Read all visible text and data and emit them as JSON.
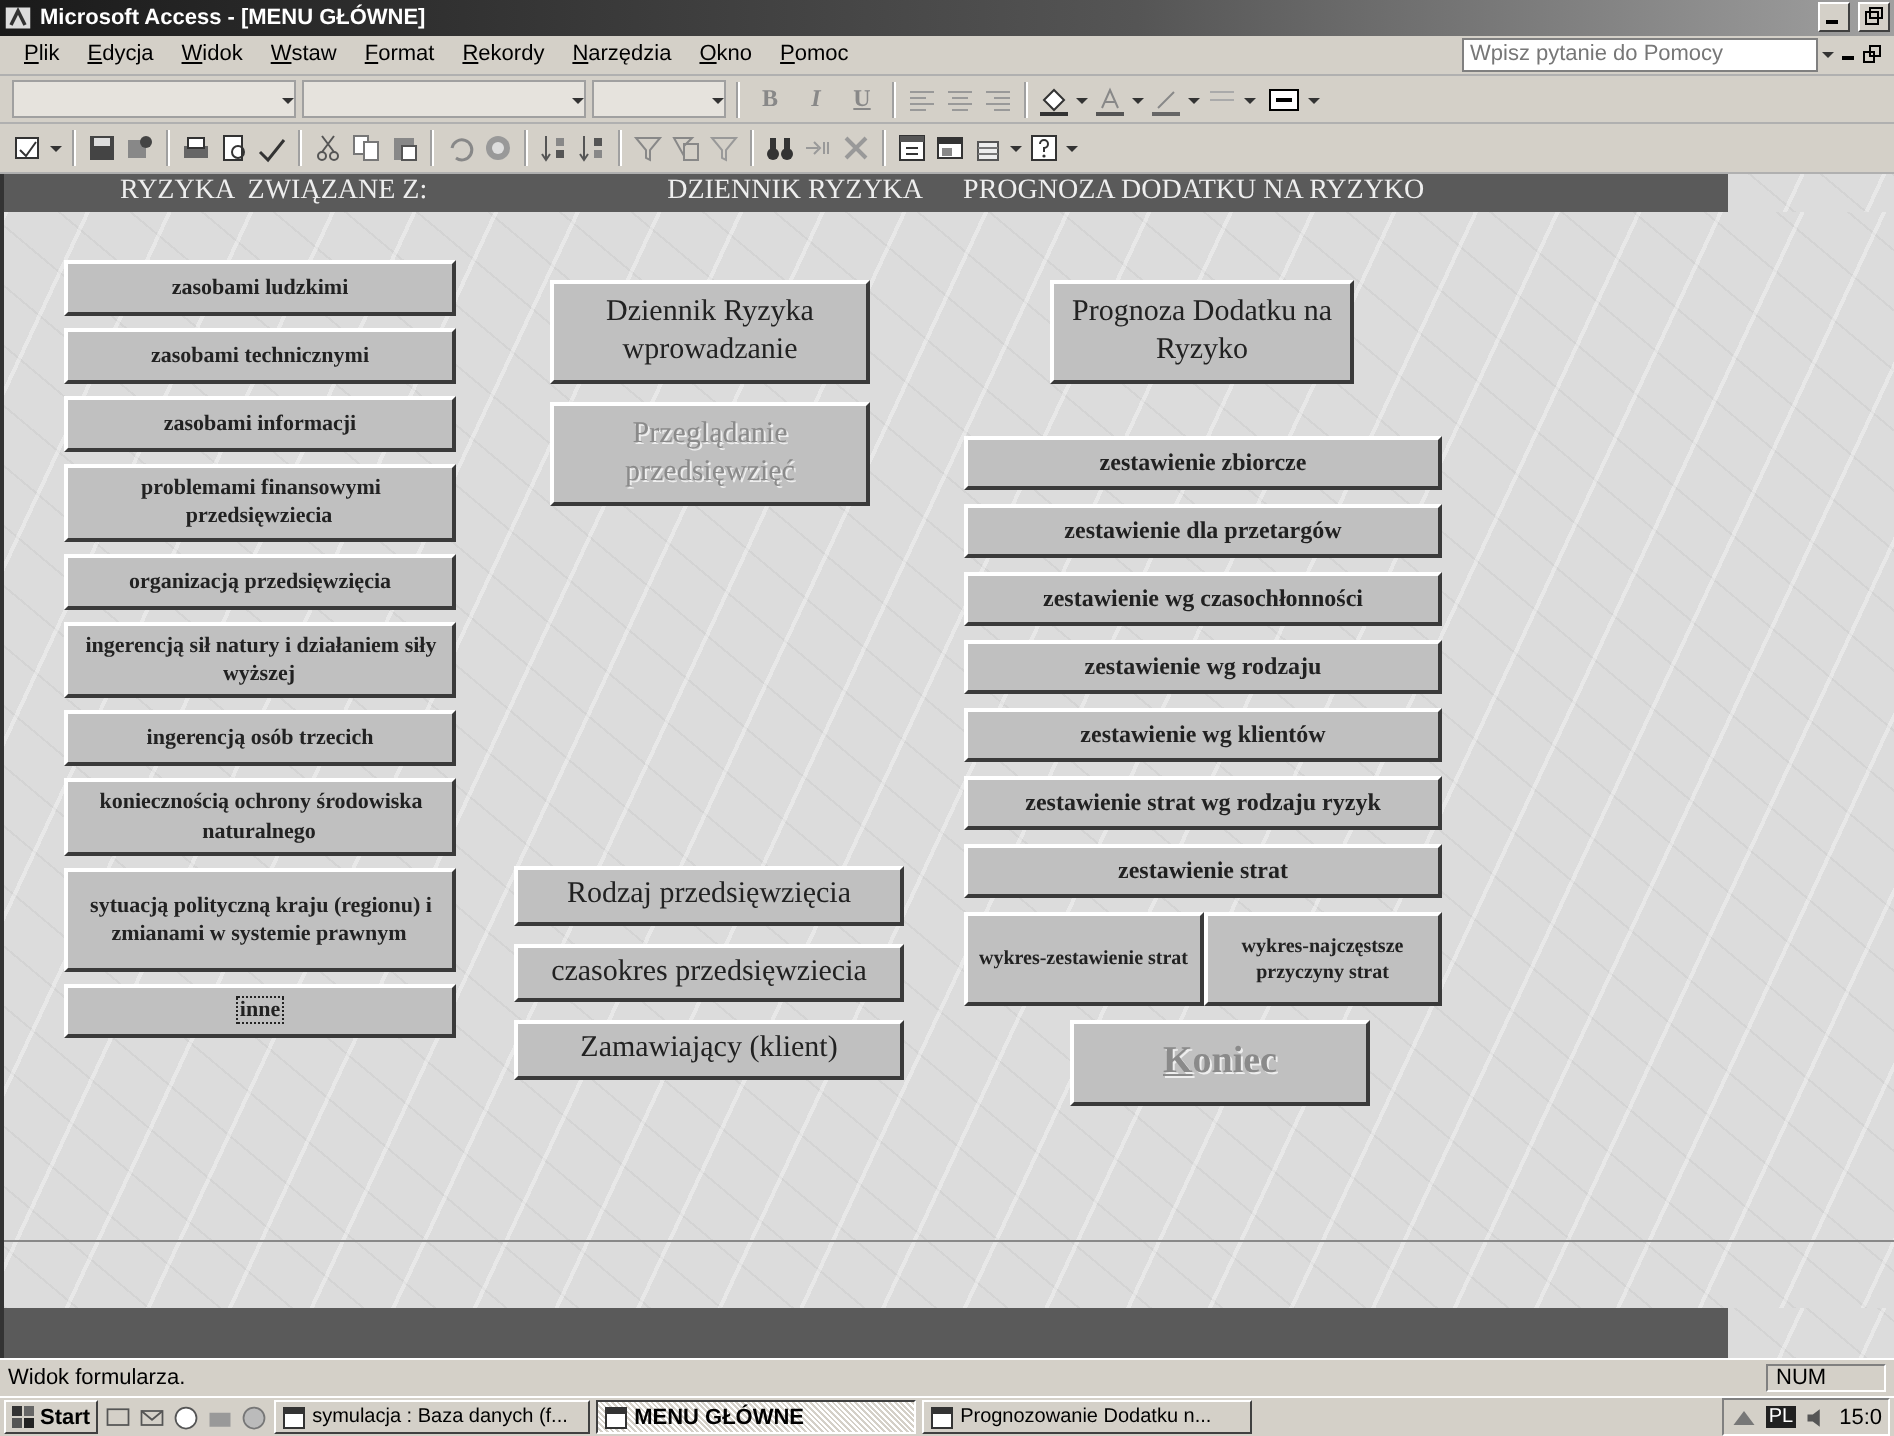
{
  "window": {
    "title": "Microsoft Access - [MENU GŁÓWNE]"
  },
  "menu": [
    "Plik",
    "Edycja",
    "Widok",
    "Wstaw",
    "Format",
    "Rekordy",
    "Narzędzia",
    "Okno",
    "Pomoc"
  ],
  "help_box": {
    "placeholder": "Wpisz pytanie do Pomocy"
  },
  "format_toolbar": {
    "buttons": [
      "B",
      "I",
      "U"
    ]
  },
  "headers": [
    "RYZYKA  ZWIĄZANE Z:",
    "DZIENNIK RYZYKA",
    "PROGNOZA DODATKU NA RYZYKO"
  ],
  "risk_buttons": [
    {
      "label": "zasobami ludzkimi",
      "focused": false
    },
    {
      "label": "zasobami technicznymi",
      "focused": false
    },
    {
      "label": "zasobami informacji",
      "focused": false
    },
    {
      "label": "problemami finansowymi przedsięwziecia",
      "focused": false
    },
    {
      "label": "organizacją przedsięwzięcia",
      "focused": false
    },
    {
      "label": "ingerencją sił natury i działaniem siły wyższej",
      "focused": false
    },
    {
      "label": "ingerencją osób trzecich",
      "focused": false
    },
    {
      "label": "koniecznością ochrony środowiska naturalnego",
      "focused": false
    },
    {
      "label": "sytuacją polityczną kraju (regionu) i zmianami w systemie prawnym",
      "focused": false
    },
    {
      "label": "inne",
      "focused": true
    }
  ],
  "journal_buttons": [
    {
      "label": "Dziennik Ryzyka wprowadzanie",
      "disabled": false
    },
    {
      "label": "Przeglądanie przedsięwzięć",
      "disabled": true
    }
  ],
  "project_buttons": [
    "Rodzaj przedsięwzięcia",
    "czasokres przedsięwziecia",
    "Zamawiający (klient)"
  ],
  "forecast_button": {
    "label": "Prognoza Dodatku na Ryzyko"
  },
  "report_buttons": [
    "zestawienie zbiorcze",
    "zestawienie dla przetargów",
    "zestawienie wg czasochłonności",
    "zestawienie  wg rodzaju",
    "zestawienie wg klientów",
    "zestawienie strat wg rodzaju ryzyk",
    "zestawienie strat"
  ],
  "chart_buttons": [
    "wykres-zestawienie strat",
    "wykres-najczęstsze przyczyny strat"
  ],
  "exit_button": {
    "label": "Koniec",
    "disabled": true
  },
  "status_bar": {
    "text": "Widok formularza.",
    "indicator": "NUM"
  },
  "taskbar": {
    "start": "Start",
    "tasks": [
      {
        "label": "symulacja : Baza danych (f...",
        "selected": false
      },
      {
        "label": "MENU GŁÓWNE",
        "selected": true
      },
      {
        "label": "Prognozowanie Dodatku n...",
        "selected": false
      }
    ],
    "language": "PL",
    "clock": "15:0"
  }
}
